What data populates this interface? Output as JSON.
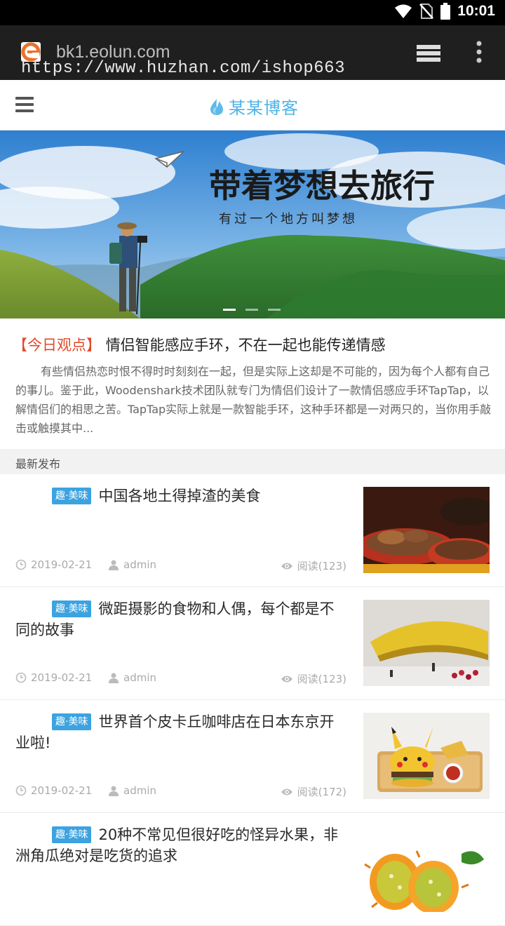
{
  "status_bar": {
    "time": "10:01"
  },
  "browser": {
    "domain": "bk1.eolun.com",
    "overlay_url": "https://www.huzhan.com/ishop663"
  },
  "site": {
    "logo_text": "某某博客"
  },
  "banner": {
    "headline": "带着梦想去旅行",
    "subline": "有过一个地方叫梦想",
    "slide_count": 3,
    "active_slide": 1
  },
  "featured": {
    "tag": "【今日观点】",
    "title": "情侣智能感应手环，不在一起也能传递情感",
    "excerpt": "有些情侣热恋时恨不得时时刻刻在一起，但是实际上这却是不可能的，因为每个人都有自己的事儿。鉴于此，Woodenshark技术团队就专门为情侣们设计了一款情侣感应手环TapTap，以解情侣们的相思之苦。TapTap实际上就是一款智能手环，这种手环都是一对两只的，当你用手敲击或触摸其中..."
  },
  "section": {
    "label": "最新发布"
  },
  "posts": [
    {
      "badge": "趣·美味",
      "title": "中国各地土得掉渣的美食",
      "date": "2019-02-21",
      "author": "admin",
      "reads": "阅读(123)",
      "thumb": "food-feast"
    },
    {
      "badge": "趣·美味",
      "title": "微距摄影的食物和人偶，每个都是不同的故事",
      "date": "2019-02-21",
      "author": "admin",
      "reads": "阅读(123)",
      "thumb": "banana-miniature"
    },
    {
      "badge": "趣·美味",
      "title": "世界首个皮卡丘咖啡店在日本东京开业啦!",
      "date": "2019-02-21",
      "author": "admin",
      "reads": "阅读(172)",
      "thumb": "pikachu-burger"
    },
    {
      "badge": "趣·美味",
      "title": "20种不常见但很好吃的怪异水果，非洲角瓜绝对是吃货的追求",
      "date": "",
      "author": "",
      "reads": "",
      "thumb": "horned-melon"
    }
  ],
  "colors": {
    "accent": "#3ca3e0",
    "tag_red": "#e04a2a",
    "logo_blue": "#4fb3e8"
  },
  "icons": [
    "wifi-icon",
    "no-sim-icon",
    "battery-icon",
    "site-favicon-icon",
    "tabs-icon",
    "more-vertical-icon",
    "hamburger-menu-icon",
    "flame-logo-icon",
    "clock-icon",
    "user-icon",
    "eye-icon",
    "paper-plane-icon"
  ]
}
